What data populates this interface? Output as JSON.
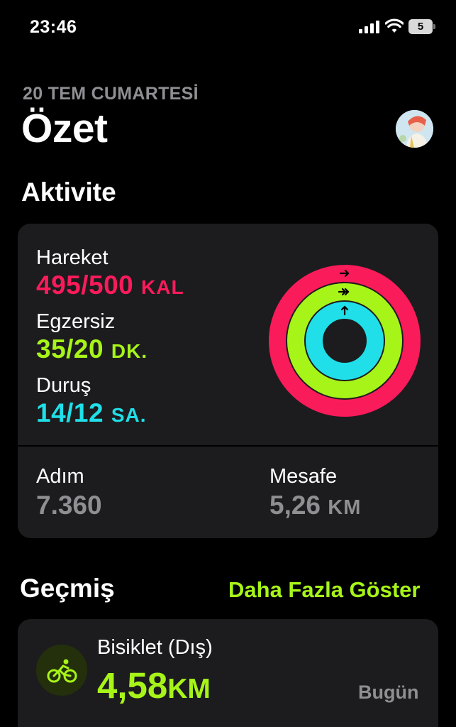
{
  "status_bar": {
    "time": "23:46",
    "battery": "5"
  },
  "header": {
    "date": "20 TEM CUMARTESİ",
    "title": "Özet"
  },
  "activity": {
    "section_title": "Aktivite",
    "move": {
      "label": "Hareket",
      "value": "495/500",
      "unit": "KAL",
      "progress": 0.99,
      "color": "#fa1b5b"
    },
    "exercise": {
      "label": "Egzersiz",
      "value": "35/20",
      "unit": "DK.",
      "progress": 1.75,
      "color": "#a7f418"
    },
    "stand": {
      "label": "Duruş",
      "value": "14/12",
      "unit": "SA.",
      "progress": 1.17,
      "color": "#20dfe8"
    },
    "steps": {
      "label": "Adım",
      "value": "7.360"
    },
    "distance": {
      "label": "Mesafe",
      "value": "5,26",
      "unit": "KM"
    }
  },
  "history": {
    "section_title": "Geçmiş",
    "show_more": "Daha Fazla Göster",
    "workouts": [
      {
        "name": "Bisiklet (Dış)",
        "distance": "4,58",
        "unit": "KM",
        "date": "Bugün",
        "icon": "cycling-icon"
      }
    ]
  }
}
